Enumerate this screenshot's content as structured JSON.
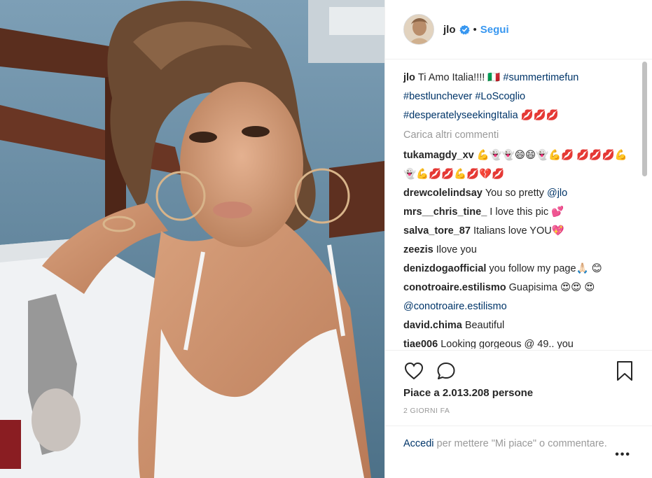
{
  "post": {
    "username": "jlo",
    "follow_label": "Segui",
    "separator": "•"
  },
  "caption": {
    "username": "jlo",
    "text": "Ti Amo Italia!!!! 🇮🇹 ",
    "tags_line1": "#summertimefun",
    "tags_line2": "#bestlunchever #LoScoglio",
    "tags_line3": "#desperatelyseekingItalia",
    "emoji_line3": " 💋💋💋"
  },
  "load_more_label": "Carica altri commenti",
  "comments": [
    {
      "user": "tukamagdy_xv",
      "text": "💪👻👻😄😄👻💪💋 💋💋💋💪👻💪💋💋💪💋💔💋"
    },
    {
      "user": "drewcolelindsay",
      "text": "You so pretty ",
      "mention": "@jlo"
    },
    {
      "user": "mrs__chris_tine_",
      "text": "I love this pic 💕"
    },
    {
      "user": "salva_tore_87",
      "text": "Italians love YOU💖"
    },
    {
      "user": "zeezis",
      "text": "Ilove you"
    },
    {
      "user": "denizdogaofficial",
      "text": "you follow my page🙏🏻 😊"
    },
    {
      "user": "conotroaire.estilismo",
      "text": "Guapisima 😍😍 😍",
      "mention": "@conotroaire.estilismo"
    },
    {
      "user": "david.chima",
      "text": "Beautiful"
    },
    {
      "user": "tiae006",
      "text": "Looking gorgeous @ 49.. you"
    }
  ],
  "likes_text": "Piace a 2.013.208 persone",
  "date_text": "2 GIORNI FA",
  "login": {
    "link": "Accedi",
    "rest": " per mettere \"Mi piace\" o commentare."
  },
  "more_label": "•••",
  "icons": {
    "like": "heart-icon",
    "comment": "comment-icon",
    "save": "bookmark-icon",
    "verified": "verified-badge-icon"
  },
  "colors": {
    "link_blue": "#3897f0",
    "hashtag": "#003569",
    "muted": "#999999"
  }
}
